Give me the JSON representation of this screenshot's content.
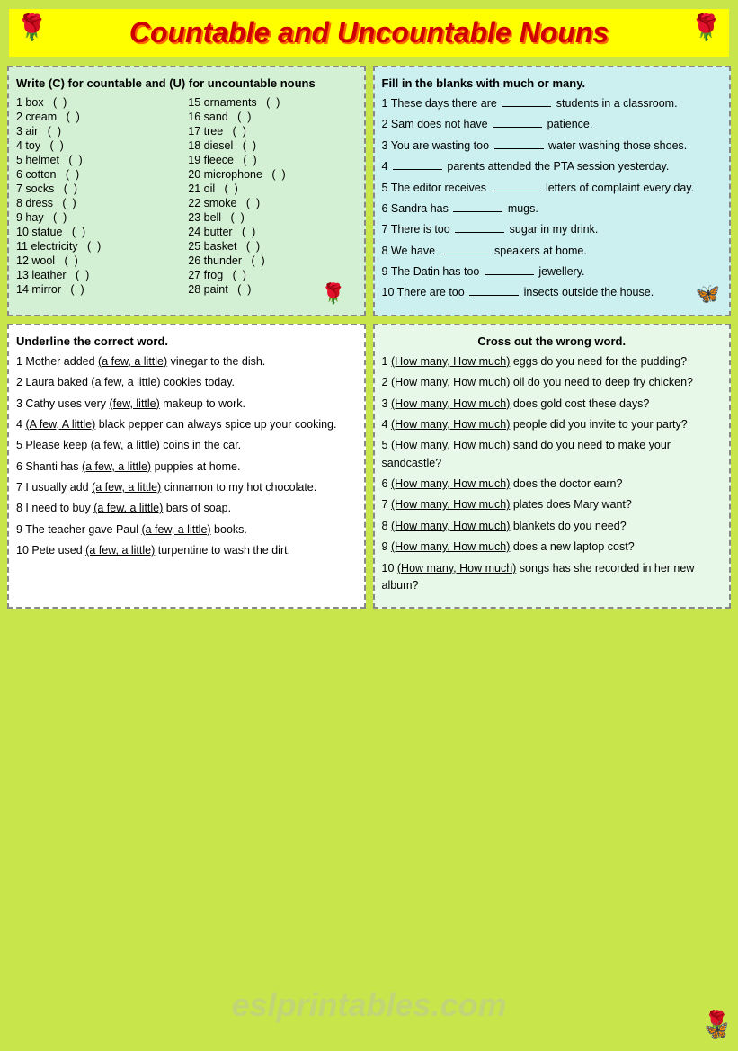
{
  "title": "Countable and Uncountable Nouns",
  "section1": {
    "instruction": "Write (C) for countable and (U) for uncountable nouns",
    "items_col1": [
      "1 box  ( )",
      "2 cream  ( )",
      "3 air  ( )",
      "4 toy  ( )",
      "5 helmet  ( )",
      "6 cotton  ( )",
      "7 socks  ( )",
      "8 dress  ( )",
      "9 hay  ( )",
      "10 statue  ( )",
      "11 electricity  ( )",
      "12 wool  ( )",
      "13 leather  ( )",
      "14 mirror  ( )"
    ],
    "items_col2": [
      "15 ornaments  ( )",
      "16 sand  ( )",
      "17 tree  ( )",
      "18 diesel  ( )",
      "19 fleece  ( )",
      "20 microphone  ( )",
      "21 oil  ( )",
      "22 smoke  ( )",
      "23 bell  ( )",
      "24 butter  ( )",
      "25 basket  ( )",
      "26 thunder  ( )",
      "27 frog  ( )",
      "28 paint  ( )"
    ]
  },
  "section2": {
    "instruction": "Fill in the blanks with much or many.",
    "sentences": [
      "1 These days there are _______ students in a classroom.",
      "2 Sam does not have _______ patience.",
      "3 You are wasting too _______ water washing those shoes.",
      "4 _______ parents attended the PTA session yesterday.",
      "5 The editor receives _______ letters of complaint every day.",
      "6 Sandra has _______ mugs.",
      "7 There is too _______ sugar in my drink.",
      "8 We have _______ speakers at home.",
      "9 The Datin has too _______ jewellery.",
      "10 There are too _______ insects outside the house."
    ]
  },
  "section3": {
    "instruction": "Underline the correct word.",
    "sentences": [
      "1 Mother added (a few, a little) vinegar to the dish.",
      "2 Laura baked (a few, a little) cookies today.",
      "3 Cathy uses very (few, little) makeup to work.",
      "4 (A few, A little) black pepper can always spice up your cooking.",
      "5 Please keep (a few, a little) coins in the car.",
      "6 Shanti has (a few, a little) puppies at home.",
      "7 I usually add (a few, a little) cinnamon to my hot chocolate.",
      "8 I need to buy (a few, a little) bars of soap.",
      "9 The teacher gave Paul (a few, a little) books.",
      "10 Pete used (a few, a little) turpentine to wash the dirt."
    ]
  },
  "section4": {
    "instruction": "Cross out the wrong word.",
    "sentences": [
      "1 (How many, How much) eggs do you need for the pudding?",
      "2 (How many, How much) oil do you need to deep fry chicken?",
      "3 (How many, How much) does gold cost these days?",
      "4 (How many, How much) people did you invite to your party?",
      "5 (How many, How much) sand do you need to make your sandcastle?",
      "6 (How many, How much) does the doctor earn?",
      "7 (How many, How much) plates does Mary want?",
      "8 (How many, How much) blankets do you need?",
      "9 (How many, How much) does a new laptop cost?",
      "10 (How many, How much) songs has she recorded in her new album?"
    ]
  }
}
